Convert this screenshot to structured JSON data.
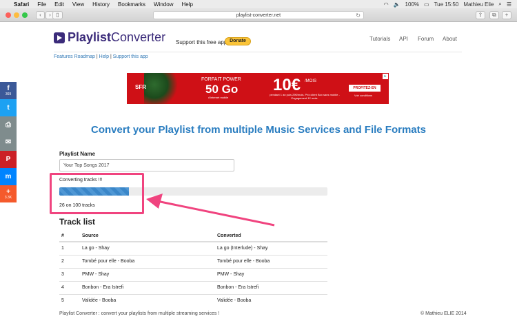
{
  "menubar": {
    "apple": "",
    "app": "Safari",
    "items": [
      "File",
      "Edit",
      "View",
      "History",
      "Bookmarks",
      "Window",
      "Help"
    ],
    "battery": "100%",
    "clock": "Tue 15:50",
    "user": "Mathieu Elie"
  },
  "browser": {
    "url": "playlist-converter.net"
  },
  "site": {
    "logo_bold": "Playlist",
    "logo_light": "Converter",
    "support_text": "Support this free app",
    "donate_label": "Donate",
    "nav": [
      "Tutorials",
      "API",
      "Forum",
      "About"
    ],
    "sublinks": [
      "Features Roadmap",
      "Help",
      "Support this app"
    ],
    "sublink_sep": " | "
  },
  "ad": {
    "brand": "SFR",
    "line1": "FORFAIT POWER",
    "line2": "50 Go",
    "line3": "d'internet mobile",
    "price": "10€",
    "per_month": "/MOIS",
    "fine": "pendant 1 an puis 25€/mois. Prix client Box sans mobile - Engagement 12 mois.",
    "cta": "PROFITEZ-EN",
    "conditions": "Voir conditions"
  },
  "main": {
    "headline": "Convert your Playlist from multiple Music Services and File Formats",
    "playlist_label": "Playlist Name",
    "playlist_value": "Your Top Songs 2017",
    "converting_text": "Converting tracks !!!",
    "progress_fraction": 0.26,
    "count_text": "26 on 100 tracks",
    "tracklist_title": "Track list"
  },
  "tracks": {
    "headers": [
      "#",
      "Source",
      "Converted"
    ],
    "rows": [
      [
        "1",
        "La go - Shay",
        "La go (Interlude) - Shay"
      ],
      [
        "2",
        "Tombé pour elle - Booba",
        "Tombé pour elle - Booba"
      ],
      [
        "3",
        "PMW - Shay",
        "PMW - Shay"
      ],
      [
        "4",
        "Bonbon - Era Istrefi",
        "Bonbon - Era Istrefi"
      ],
      [
        "5",
        "Validée - Booba",
        "Validée - Booba"
      ]
    ]
  },
  "footer": {
    "left": "Playlist Converter : convert your playlists from multiple streaming services !",
    "right": "© Mathieu ELIE 2014"
  },
  "social": [
    {
      "name": "facebook",
      "glyph": "f",
      "count": "369",
      "color": "#3b5998"
    },
    {
      "name": "twitter",
      "glyph": "t",
      "count": "",
      "color": "#1da1f2"
    },
    {
      "name": "print",
      "glyph": "⎙",
      "count": "",
      "color": "#7f8c8d"
    },
    {
      "name": "email",
      "glyph": "✉",
      "count": "",
      "color": "#7f8c8d"
    },
    {
      "name": "pinterest",
      "glyph": "P",
      "count": "",
      "color": "#cb2027"
    },
    {
      "name": "messenger",
      "glyph": "m",
      "count": "",
      "color": "#0084ff"
    },
    {
      "name": "more",
      "glyph": "+",
      "count": "3.3K",
      "color": "#f55a2c"
    }
  ],
  "colors": {
    "accent": "#2a7dc0",
    "highlight": "#f0447f",
    "logo": "#3b2b7a"
  }
}
